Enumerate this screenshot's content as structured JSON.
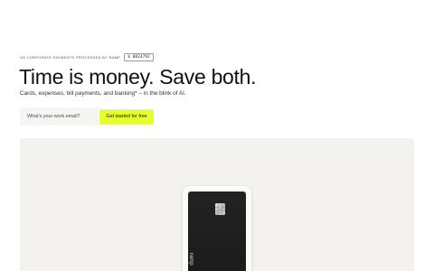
{
  "hero": {
    "eyebrow_text": "US CORPORATE PAYMENTS PROCESSED BY RAMP",
    "ticker_value": "$ 8824792",
    "headline": "Time is money. Save both.",
    "subline": "Cards, expenses, bill payments, and banking* – in the blink of AI."
  },
  "signup": {
    "email_placeholder": "What's your work email?",
    "cta_label": "Get started for free"
  },
  "showcase": {
    "card_mark_text": "ramp"
  },
  "colors": {
    "cta_accent": "#e6ff2e",
    "showcase_background": "#f3f2ee",
    "card_background": "#1f1f1f"
  },
  "icons": {
    "card_chip": "chip-icon"
  }
}
